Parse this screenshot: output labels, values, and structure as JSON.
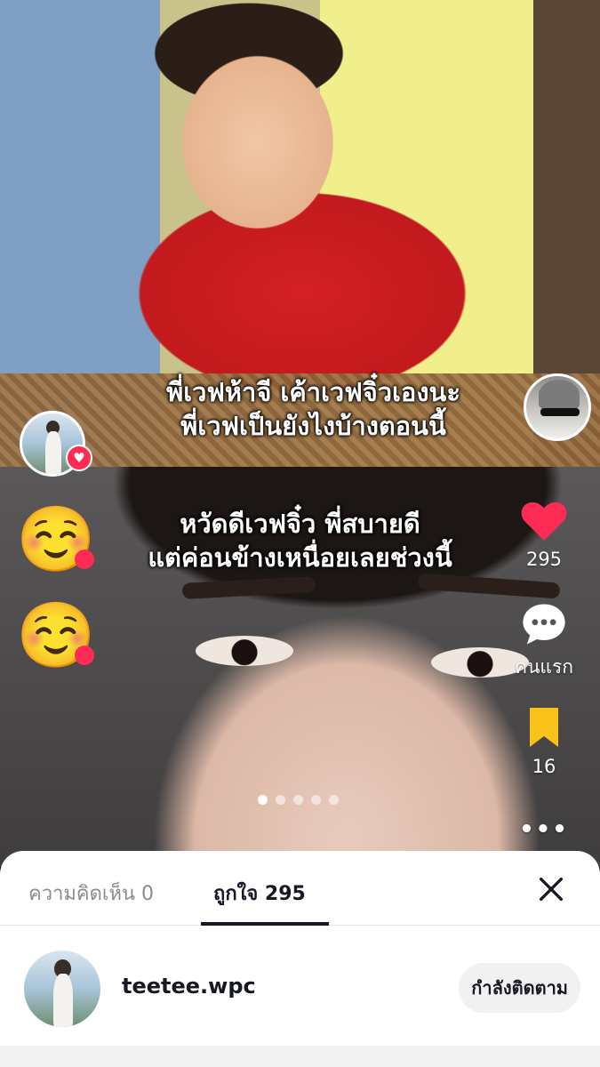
{
  "post": {
    "caption_top_line1": "พี่เวฟห้าจี เค้าเวฟจิ๋วเองนะ",
    "caption_top_line2": "พี่เวฟเป็นยังไงบ้างตอนนี้",
    "caption_mid_line1": "หวัดดีเวฟจิ๋ว พี่สบายดี",
    "caption_mid_line2": "แต่ค่อนข้างเหนื่อยเลยช่วงนี้",
    "reaction_emoji": "☺️",
    "carousel_total": 5,
    "carousel_active": 1
  },
  "rail": {
    "like_count": "295",
    "comment_label": "คนแรก",
    "save_count": "16",
    "more_label": "•••",
    "accent": "#fe2c55",
    "save_color": "#f9c21b"
  },
  "sheet": {
    "tab_comments": "ความคิดเห็น 0",
    "tab_likes": "ถูกใจ 295",
    "user": {
      "username": "teetee.wpc",
      "follow_label": "กำลังติดตาม"
    }
  }
}
